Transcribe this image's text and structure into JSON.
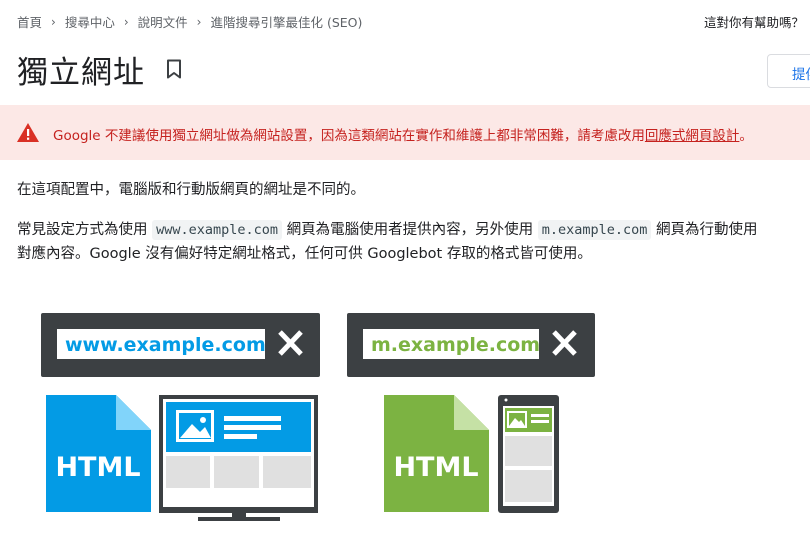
{
  "breadcrumb": {
    "items": [
      "首頁",
      "搜尋中心",
      "說明文件",
      "進階搜尋引擎最佳化 (SEO)"
    ]
  },
  "helpful_prompt": "這對你有幫助嗎？",
  "page": {
    "title": "獨立網址",
    "feedback_button": "提供"
  },
  "warning": {
    "brand": "Google",
    "text": " 不建議使用獨立網址做為網站設置，因為這類網站在實作和維護上都非常困難，請考慮改用",
    "link": "回應式網頁設計",
    "end": "。"
  },
  "paragraph1": "在這項配置中，電腦版和行動版網頁的網址是不同的。",
  "paragraph2": {
    "part1": "常見設定方式為使用 ",
    "code1": "www.example.com",
    "part2": " 網頁為電腦使用者提供內容，另外使用 ",
    "code2": "m.example.com",
    "part3": " 網頁為行動使用",
    "line2": "對應內容。Google 沒有偏好特定網址格式，任何可供 Googlebot 存取的格式皆可使用。"
  },
  "illustration": {
    "desktop_url": "www.example.com",
    "mobile_url": "m.example.com",
    "desktop_file_label": "HTML",
    "mobile_file_label": "HTML"
  },
  "colors": {
    "link": "#1a73e8",
    "warning_bg": "#fce8e6",
    "warning_text": "#c5221f",
    "desktop_blue": "#039be5",
    "mobile_green": "#7cb342",
    "bar_dark": "#3c4043"
  },
  "icons": {
    "separator": "chevron-right-icon",
    "bookmark": "bookmark-icon",
    "warning": "warning-icon",
    "close": "close-icon"
  }
}
